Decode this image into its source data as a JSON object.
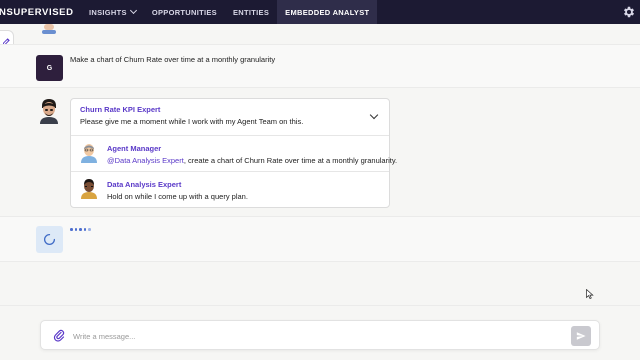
{
  "app": {
    "logo": "NSUPERVISED"
  },
  "nav": {
    "items": [
      {
        "label": "INSIGHTS",
        "has_dropdown": true
      },
      {
        "label": "OPPORTUNITIES"
      },
      {
        "label": "ENTITIES"
      },
      {
        "label": "EMBEDDED ANALYST",
        "active": true
      }
    ],
    "settings_icon": "gear-icon"
  },
  "conversation": {
    "user_message": {
      "avatar_initial": "G",
      "text": "Make a chart of Churn Rate over time at a monthly granularity"
    },
    "agent_message": {
      "agent_name": "Churn Rate KPI Expert",
      "text": "Please give me a moment while I work with my Agent Team on this.",
      "sub_messages": [
        {
          "name": "Agent Manager",
          "mention": "@Data Analysis Expert",
          "text": ", create a chart of Churn Rate over time at a monthly granularity."
        },
        {
          "name": "Data Analysis Expert",
          "text": "Hold on while I come up with a query plan."
        }
      ]
    }
  },
  "composer": {
    "placeholder": "Write a message...",
    "value": ""
  },
  "colors": {
    "nav_bg": "#1c1a33",
    "accent": "#5a39c8",
    "user_avatar_bg": "#2e1f3d"
  }
}
